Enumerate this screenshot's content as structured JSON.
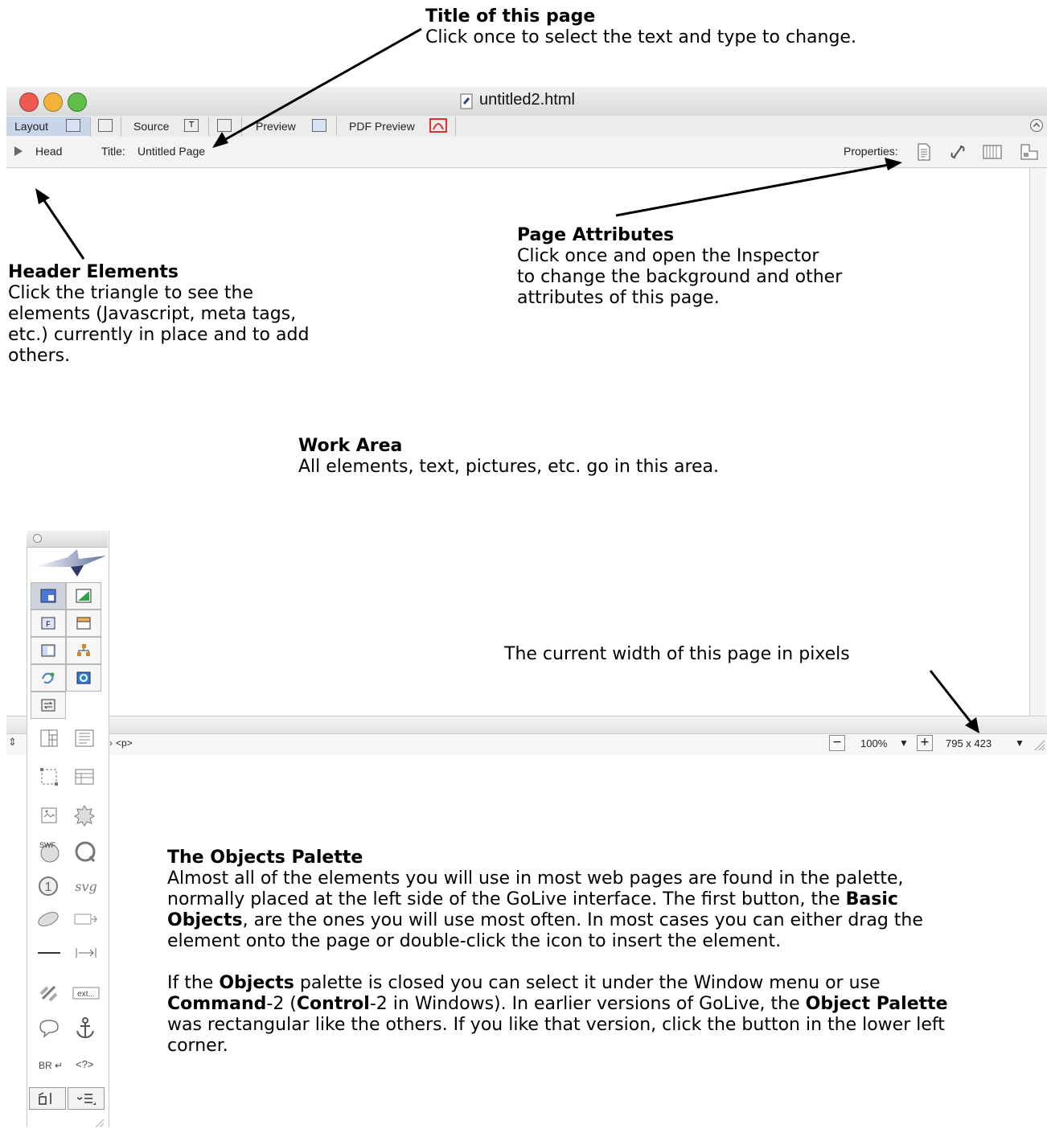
{
  "annotations": {
    "title_page": {
      "heading": "Title of this page",
      "line1": "Click once to select the text and type to change."
    },
    "header_elements": {
      "heading": "Header Elements",
      "lines": [
        "Click the triangle to see the",
        "elements (Javascript, meta tags,",
        "etc.) currently in place and to add",
        "others."
      ]
    },
    "page_attributes": {
      "heading": "Page Attributes",
      "lines": [
        "Click once and open the Inspector",
        "to change the background and other",
        "attributes of this page."
      ]
    },
    "work_area": {
      "heading": "Work Area",
      "line1": "All elements, text, pictures, etc. go in this area."
    },
    "width_note": "The current width of this page in pixels"
  },
  "window": {
    "title": "untitled2.html",
    "tabs": [
      {
        "label": "Layout"
      },
      {
        "label": "Source"
      },
      {
        "label": "Preview"
      },
      {
        "label": "PDF Preview"
      }
    ],
    "head_label": "Head",
    "title_label": "Title:",
    "title_value": "Untitled Page",
    "properties_label": "Properties:",
    "status": {
      "tag_path": "<p>",
      "zoom": "100%",
      "size": "795 x 423"
    }
  },
  "objects_palette": {
    "tool_icons": [
      "layout-icon",
      "css-icon",
      "form-icon",
      "frame-icon",
      "table-icon",
      "site-icon",
      "smart-icon",
      "quicktime-icon",
      "sync-icon"
    ],
    "basic_icons": [
      "layout-grid-icon",
      "layout-text-box-icon",
      "floating-box-icon",
      "table-icon",
      "image-icon",
      "plugin-icon",
      "swf-icon",
      "quicktime-icon",
      "real-icon",
      "svg-icon",
      "applet-icon",
      "object-icon",
      "line-icon",
      "spacer-icon",
      "link-icon",
      "text-icon",
      "comment-icon",
      "anchor-icon",
      "line-break-icon",
      "script-icon"
    ],
    "labels": {
      "swf": "SWF",
      "svg": "svg",
      "br": "BR",
      "code": "<?>",
      "ext": "ext..."
    }
  },
  "body_text": {
    "heading": "The Objects Palette",
    "p1": [
      "Almost all of the elements you will use in most web pages are found in the palette,",
      "normally placed at the left side of the GoLive interface.  The first button, the ",
      "Basic",
      "Objects",
      ", are the ones you will use most often.  In most cases you can either drag the",
      "element onto the page or double-click the icon to insert the element."
    ],
    "p2": {
      "l1a": "If the ",
      "l1b": "Objects",
      "l1c": " palette is closed you can select it under the Window menu or use",
      "l2a": "Command",
      "l2b": "-2 (",
      "l2c": "Control",
      "l2d": "-2 in Windows).  In earlier versions of GoLive, the ",
      "l2e": "Object Palette",
      "l3": "was rectangular like the others.  If you like that version, click the button in the lower left",
      "l4": "corner."
    }
  },
  "colors": {
    "close": "#ee5a4f",
    "minimize": "#f4b23a",
    "zoom": "#5fbf4a",
    "selected_tab": "#c9d6ea"
  }
}
